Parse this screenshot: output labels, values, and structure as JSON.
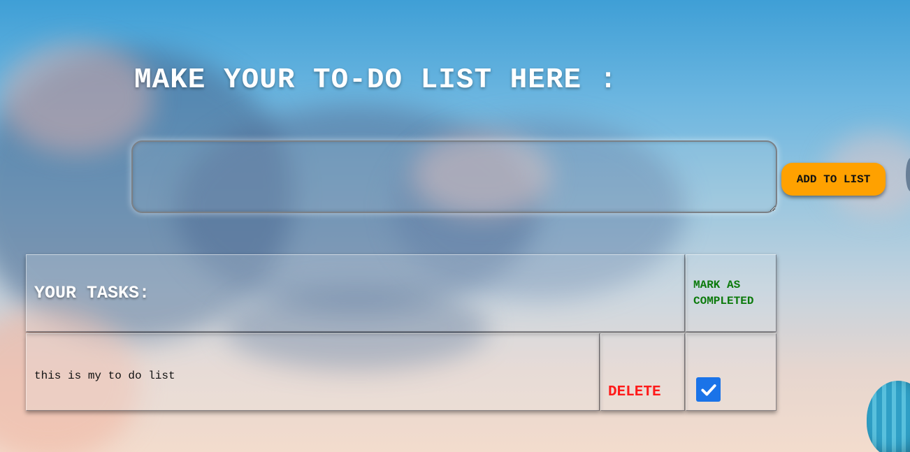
{
  "page": {
    "title": "MAKE YOUR TO-DO LIST HERE :"
  },
  "form": {
    "input_value": "",
    "add_button_label": "ADD TO LIST"
  },
  "table": {
    "header_tasks": "YOUR TASKS:",
    "header_completed": "MARK AS COMPLETED",
    "rows": [
      {
        "task": "this is my to do list",
        "delete_label": "DELETE",
        "completed": true
      }
    ]
  },
  "colors": {
    "button_bg": "#ffa100",
    "delete_text": "#ff1a1a",
    "completed_header_text": "#0b7a0b",
    "checkbox_bg": "#1a73e8"
  },
  "icons": {
    "checkbox": "checkmark-icon"
  }
}
